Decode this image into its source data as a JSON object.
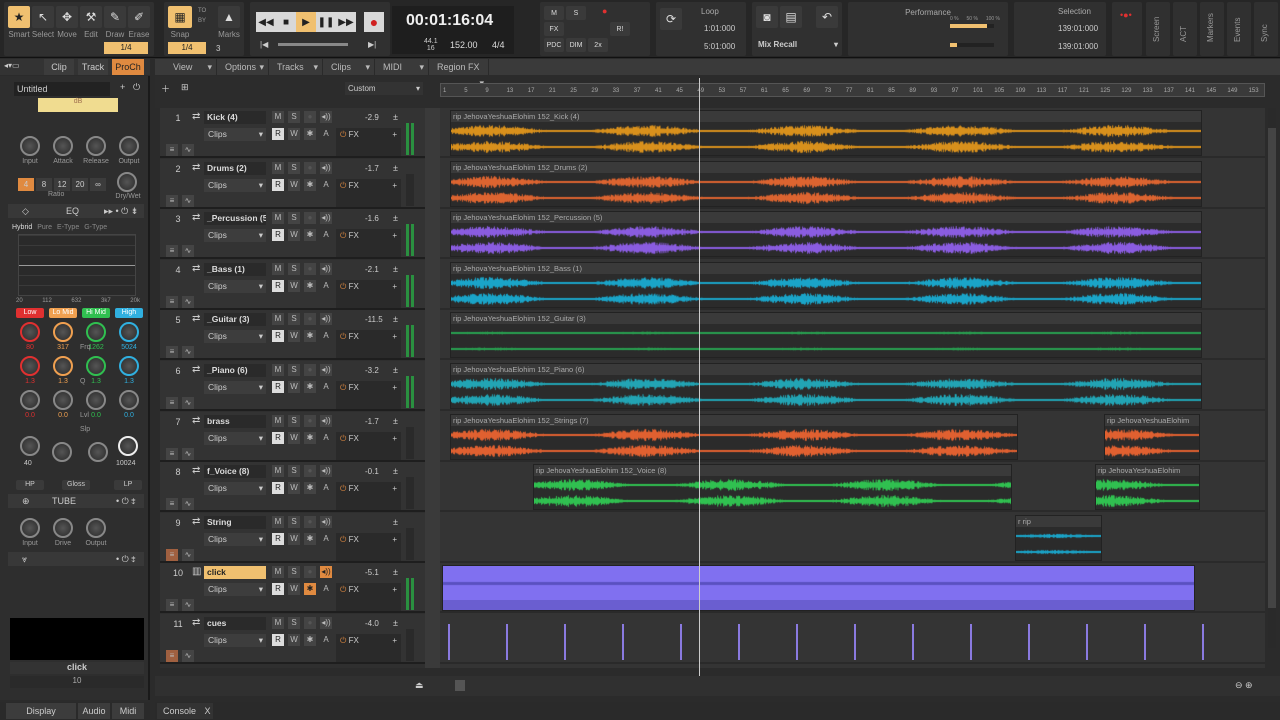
{
  "toolbar": {
    "tools": [
      {
        "label": "Smart",
        "icon": "star-icon"
      },
      {
        "label": "Select",
        "icon": "cursor-icon"
      },
      {
        "label": "Move",
        "icon": "move-icon"
      },
      {
        "label": "Edit",
        "icon": "edit-icon"
      },
      {
        "label": "Draw",
        "icon": "pencil-icon"
      },
      {
        "label": "Erase",
        "icon": "eraser-icon"
      }
    ],
    "tool_snap_value": "1/4",
    "snap_label": "Snap",
    "snap_value": "1/4",
    "snap_extra": "3",
    "snap_to": "TO",
    "snap_by": "BY",
    "marks_label": "Marks",
    "clock": "00:01:16:04",
    "sample_rate": "44.1",
    "bit_depth": "16",
    "tempo": "152.00",
    "meter": "4/4",
    "mix": [
      "M",
      "S",
      "FX",
      "PDC",
      "DIM",
      "2x",
      "R!"
    ],
    "loop": {
      "label": "Loop",
      "start": "1:01:000",
      "end": "5:01:000"
    },
    "mix_recall": "Mix Recall",
    "performance": {
      "label": "Performance",
      "scale": [
        "0 %",
        "50 %",
        "100 %"
      ],
      "cpu": 0.85,
      "disk": 0.15
    },
    "selection": {
      "label": "Selection",
      "start": "139:01:000",
      "end": "139:01:000"
    },
    "side_tabs": [
      "Screen",
      "ACT",
      "Markers",
      "Events",
      "Sync"
    ]
  },
  "inspector": {
    "tabs": [
      "Clip",
      "Track",
      "ProCh"
    ],
    "preset": "Untitled",
    "comp": {
      "meter_label": "dB",
      "knobs": [
        "Input",
        "Attack",
        "Release",
        "Output"
      ],
      "ratios": [
        "4",
        "8",
        "12",
        "20",
        "∞"
      ],
      "ratio_label": "Ratio",
      "drywet": "Dry/Wet"
    },
    "eq": {
      "label": "EQ",
      "modes": [
        "Hybrid",
        "Pure",
        "E-Type",
        "G-Type"
      ],
      "freq_ticks": [
        "20",
        "112",
        "632",
        "3k7",
        "20k"
      ],
      "bands": [
        {
          "name": "Low",
          "color": "#e03030",
          "freq": "80",
          "q": "1.3",
          "lvl": "0.0"
        },
        {
          "name": "Lo Mid",
          "color": "#f0a050",
          "freq": "317",
          "q": "1.3",
          "lvl": "0.0"
        },
        {
          "name": "Hi Mid",
          "color": "#30c050",
          "freq": "1262",
          "q": "1.3",
          "lvl": "0.0"
        },
        {
          "name": "High",
          "color": "#30b0e0",
          "freq": "5024",
          "q": "1.3",
          "lvl": "0.0"
        }
      ],
      "row_labels": [
        "Frq",
        "Q",
        "Lvl",
        "Slp"
      ],
      "hp": "HP",
      "hp_freq": "40",
      "gloss": "Gloss",
      "lp": "LP",
      "lp_freq": "10024"
    },
    "tube": {
      "label": "TUBE",
      "knobs": [
        "Input",
        "Drive",
        "Output"
      ]
    },
    "track_name": "click",
    "track_number": "10",
    "bottom_tabs": [
      "Display",
      "Audio",
      "Midi"
    ]
  },
  "menus": [
    "View",
    "Options",
    "Tracks",
    "Clips",
    "MIDI",
    "Region FX"
  ],
  "preset_dropdown": "Custom",
  "ruler": [
    "1",
    "5",
    "9",
    "13",
    "17",
    "21",
    "25",
    "29",
    "33",
    "37",
    "41",
    "45",
    "49",
    "53",
    "57",
    "61",
    "65",
    "69",
    "73",
    "77",
    "81",
    "85",
    "89",
    "93",
    "97",
    "101",
    "105",
    "109",
    "113",
    "117",
    "121",
    "125",
    "129",
    "133",
    "137",
    "141",
    "145",
    "149",
    "153"
  ],
  "track_labels": {
    "clips": "Clips",
    "m": "M",
    "s": "S",
    "r": "R",
    "w": "W",
    "a": "A",
    "fx": "FX"
  },
  "tracks": [
    {
      "num": "1",
      "name": "Kick (4)",
      "vol": "-2.9",
      "color": "#d8901c",
      "clips": [
        {
          "label": "rip JehovaYeshuaElohim 152_Kick (4)"
        }
      ]
    },
    {
      "num": "2",
      "name": "Drums (2)",
      "vol": "-1.7",
      "color": "#dc6430",
      "clips": [
        {
          "label": "rip JehovaYeshuaElohim 152_Drums (2)"
        }
      ]
    },
    {
      "num": "3",
      "name": "_Percussion (5)",
      "vol": "-1.6",
      "color": "#8a5ce0",
      "clips": [
        {
          "label": "rip JehovaYeshuaElohim 152_Percussion (5)"
        }
      ]
    },
    {
      "num": "4",
      "name": "_Bass (1)",
      "vol": "-2.1",
      "color": "#1aa4c8",
      "clips": [
        {
          "label": "rip JehovaYeshuaElohim 152_Bass (1)"
        }
      ]
    },
    {
      "num": "5",
      "name": "_Guitar (3)",
      "vol": "-11.5",
      "color": "#28a050",
      "clips": [
        {
          "label": "rip JehovaYeshuaElohim 152_Guitar (3)"
        }
      ]
    },
    {
      "num": "6",
      "name": "_Piano (6)",
      "vol": "-3.2",
      "color": "#22a4b4",
      "clips": [
        {
          "label": "rip JehovaYeshuaElohim 152_Piano (6)"
        }
      ]
    },
    {
      "num": "7",
      "name": "brass",
      "vol": "-1.7",
      "color": "#e06030",
      "clips": [
        {
          "label": "rip JehovaYeshuaElohim 152_Strings (7)"
        },
        {
          "label": "rip JehovaYeshuaElohim"
        }
      ]
    },
    {
      "num": "8",
      "name": "f_Voice (8)",
      "vol": "-0.1",
      "color": "#30c050",
      "clips": [
        {
          "label": "rip JehovaYeshuaElohim 152_Voice (8)"
        },
        {
          "label": "rip JehovaYeshuaElohim"
        }
      ]
    },
    {
      "num": "9",
      "name": "String",
      "vol": "",
      "color": "#1aa4c8",
      "clips": [
        {
          "label": "r rip"
        }
      ]
    },
    {
      "num": "10",
      "name": "click",
      "vol": "-5.1",
      "color": "#7a6ee0",
      "clips": [
        {
          "label": ""
        }
      ]
    },
    {
      "num": "11",
      "name": "cues",
      "vol": "-4.0",
      "color": "#8a7ae0",
      "clips": []
    }
  ],
  "console": {
    "tab": "Console",
    "close": "X"
  }
}
